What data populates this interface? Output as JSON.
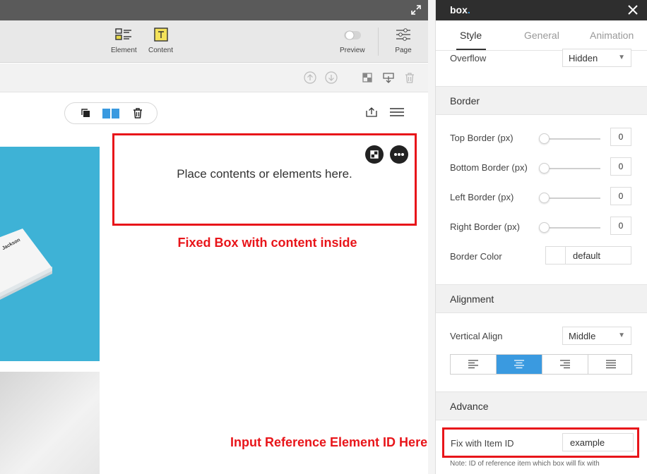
{
  "toolbar": {
    "element_label": "Element",
    "content_label": "Content",
    "preview_label": "Preview",
    "page_label": "Page"
  },
  "canvas": {
    "box_placeholder": "Place contents or elements here.",
    "card_name": "Jackson"
  },
  "annotations": {
    "fixed_box": "Fixed Box with content inside",
    "reference_id": "Input Reference Element ID Here"
  },
  "panel": {
    "title": "box",
    "title_dot": ".",
    "tabs": [
      "Style",
      "General",
      "Animation"
    ],
    "active_tab": "Style",
    "overflow": {
      "label": "Overflow",
      "value": "Hidden"
    },
    "border": {
      "heading": "Border",
      "top": {
        "label": "Top Border (px)",
        "value": "0"
      },
      "bottom": {
        "label": "Bottom Border (px)",
        "value": "0"
      },
      "left": {
        "label": "Left Border (px)",
        "value": "0"
      },
      "right": {
        "label": "Right Border (px)",
        "value": "0"
      },
      "color": {
        "label": "Border Color",
        "value": "default"
      }
    },
    "alignment": {
      "heading": "Alignment",
      "vertical": {
        "label": "Vertical Align",
        "value": "Middle"
      },
      "buttons": [
        "align-left",
        "align-center",
        "align-right",
        "align-justify"
      ],
      "active": "align-center"
    },
    "advance": {
      "heading": "Advance",
      "fix_label": "Fix with Item ID",
      "fix_value": "example",
      "note": "Note: ID of reference item which box will fix with"
    }
  },
  "colors": {
    "accent": "#3a9ae0",
    "highlight": "#e8151a",
    "topbar": "#5a5a5a",
    "panel_header": "#2e2e2e",
    "image_blue": "#3eb2d6"
  }
}
